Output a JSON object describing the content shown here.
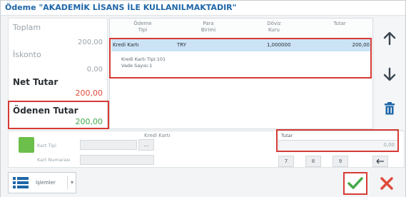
{
  "window": {
    "title": "Ödeme \"AKADEMİK LİSANS İLE KULLANILMAKTADIR\""
  },
  "summary": {
    "toplam_label": "Toplam",
    "toplam_value": "200,00",
    "iskonto_label": "İskonto",
    "iskonto_value": "0,00",
    "net_label": "Net Tutar",
    "net_value": "200,00",
    "odenen_label": "Ödenen Tutar",
    "odenen_value": "200,00"
  },
  "grid": {
    "columns": [
      {
        "line1": "Ödeme",
        "line2": "Tipi"
      },
      {
        "line1": "Para",
        "line2": "Birimi"
      },
      {
        "line1": "Döviz",
        "line2": "Kuru"
      },
      {
        "line1": "Tutar",
        "line2": ""
      }
    ],
    "rows": [
      {
        "odeme_tipi": "Kredi Kartı",
        "para_birimi": "TRY",
        "doviz_kuru": "1,000000",
        "tutar": "200,00",
        "detail1": "Kredi Kartı Tipi:101",
        "detail2": "Vade Sayısı:1"
      }
    ]
  },
  "lower": {
    "section_title": "Kredi Kartı",
    "kart_tipi_label": "Kart Tipi",
    "kart_numarasi_label": "Kart Numarası",
    "tutar_label": "Tutar",
    "tutar_value": "0,00",
    "lookup_symbol": "...",
    "buttons": [
      "7",
      "8",
      "9"
    ]
  },
  "bottom": {
    "operations_label": "İşlemler"
  },
  "colors": {
    "accent_blue": "#1e66a8",
    "highlight_red": "#d63b35",
    "ok_green": "#45a84a",
    "cancel_red": "#e04a3a",
    "selected_row": "#cbe3f5"
  }
}
